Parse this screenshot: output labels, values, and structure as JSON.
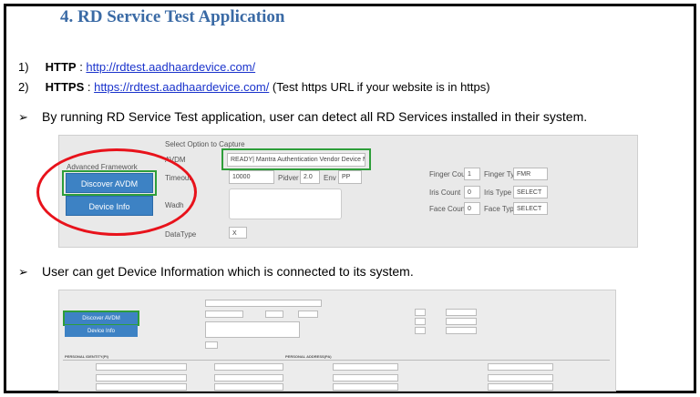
{
  "heading": "4.  RD Service Test Application",
  "list": [
    {
      "num": "1)",
      "label": "HTTP",
      "sep": " : ",
      "url": "http://rdtest.aadhaardevice.com/",
      "note": ""
    },
    {
      "num": "2)",
      "label": "HTTPS",
      "sep": " : ",
      "url": "https://rdtest.aadhaardevice.com/",
      "note": "  (Test https URL if your website is in https)"
    }
  ],
  "bullets": [
    "By running RD Service Test application, user can detect all RD Services installed in their system.",
    "User can get Device Information which is connected to its system."
  ],
  "arrow": "➢",
  "screenshot1": {
    "select_option": "Select Option to Capture",
    "avdm_label": "AVDM",
    "avdm_value": "READY| Mantra Authentication Vendor Device Manag",
    "advanced": "Advanced Framework",
    "discover_btn": "Discover AVDM",
    "device_info_btn": "Device Info",
    "timeout_label": "Timeout",
    "timeout_value": "10000",
    "pidver_label": "Pidver",
    "pidver_value": "2.0",
    "env_label": "Env",
    "env_value": "PP",
    "wadh_label": "Wadh",
    "datatype_label": "DataType",
    "datatype_value": "X",
    "finger_count_label": "Finger Count",
    "finger_count_value": "1",
    "finger_type_label": "Finger Type",
    "finger_type_value": "FMR",
    "iris_count_label": "Iris Count",
    "iris_count_value": "0",
    "iris_type_label": "Iris Type",
    "iris_type_value": "SELECT",
    "face_count_label": "Face Count",
    "face_count_value": "0",
    "face_type_label": "Face Type",
    "face_type_value": "SELECT"
  },
  "screenshot2": {
    "discover_btn": "Discover AVDM",
    "device_info_btn": "Device Info",
    "personal_identity": "PERSONAL IDENTITY(PI)",
    "personal_address": "PERSONAL ADDRESS(PA)"
  },
  "colors": {
    "heading": "#3a6aa5",
    "link": "#1a33cc",
    "button": "#3d82c4",
    "highlight_green": "#2e9e3a",
    "highlight_red": "#e8121b"
  }
}
